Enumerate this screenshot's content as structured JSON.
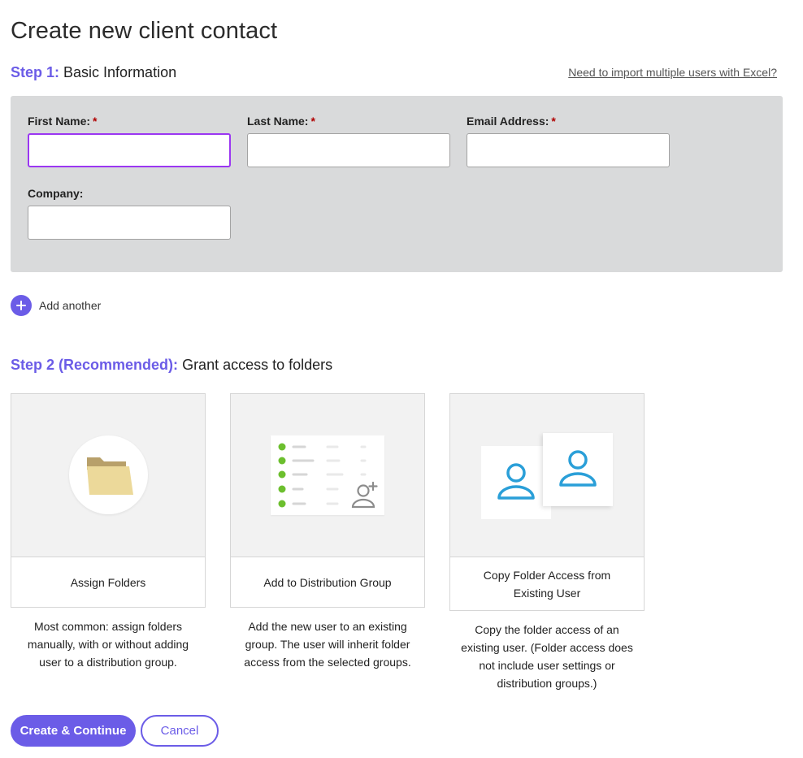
{
  "page": {
    "title": "Create new client contact"
  },
  "step1": {
    "prefix": "Step 1:",
    "title": "Basic Information",
    "import_link": "Need to import multiple users with Excel?"
  },
  "form": {
    "first_name": {
      "label": "First Name:",
      "required_mark": "*",
      "value": ""
    },
    "last_name": {
      "label": "Last Name:",
      "required_mark": "*",
      "value": ""
    },
    "email": {
      "label": "Email Address:",
      "required_mark": "*",
      "value": ""
    },
    "company": {
      "label": "Company:",
      "value": ""
    }
  },
  "add_another": {
    "label": "Add another",
    "icon": "plus-icon"
  },
  "step2": {
    "prefix": "Step 2 (Recommended):",
    "title": "Grant access to folders",
    "cards": [
      {
        "title": "Assign Folders",
        "description": "Most common: assign folders manually, with or without adding user to a distribution group.",
        "icon": "folder-icon"
      },
      {
        "title": "Add to Distribution Group",
        "description": "Add the new user to an existing group. The user will inherit folder access from the selected groups.",
        "icon": "user-list-icon"
      },
      {
        "title": "Copy Folder Access from Existing User",
        "description": "Copy the folder access of an existing user. (Folder access does not include user settings or distribution groups.)",
        "icon": "user-icon"
      }
    ]
  },
  "actions": {
    "primary": "Create & Continue",
    "secondary": "Cancel"
  },
  "colors": {
    "accent": "#6b5ce7",
    "focus_border": "#9b37f2",
    "panel_bg": "#d9dadb",
    "required": "#b00000",
    "list_bullet": "#6cbf2e",
    "user_icon": "#2a9fd8",
    "folder_fill": "#ecd99a"
  }
}
